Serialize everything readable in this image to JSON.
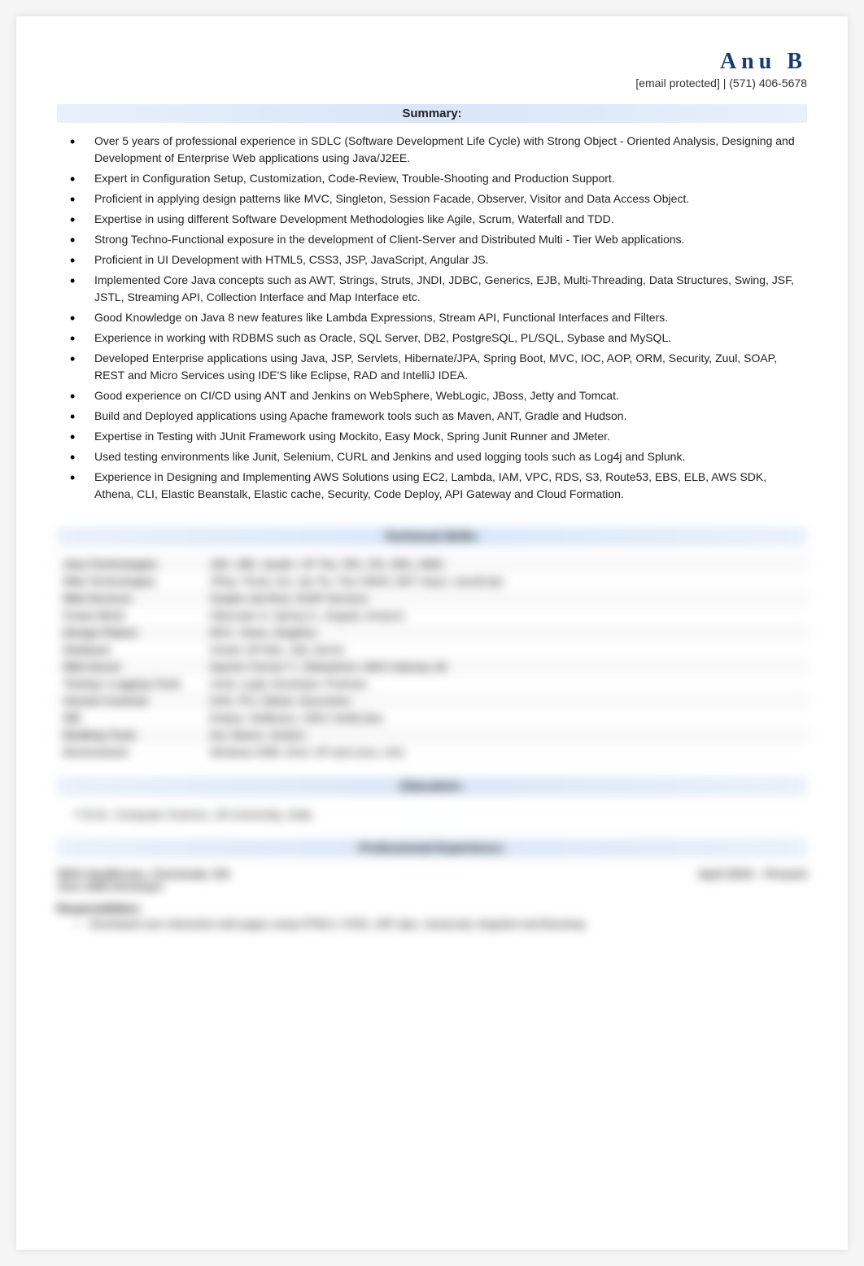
{
  "header": {
    "name": "Anu B",
    "contact": "[email protected] | (571) 406-5678"
  },
  "sections": {
    "summary_title": "Summary:",
    "skills_title": "Technical Skills:",
    "education_title": "Education:",
    "experience_title": "Professional Experience:"
  },
  "summary": [
    "Over 5 years of professional experience in SDLC (Software Development Life Cycle) with Strong Object - Oriented Analysis, Designing and Development of Enterprise Web applications using Java/J2EE.",
    "Expert in Configuration Setup, Customization, Code-Review, Trouble-Shooting and Production Support.",
    "Proficient in applying design patterns like MVC, Singleton, Session Facade, Observer, Visitor and Data Access Object.",
    "Expertise in using different Software Development Methodologies like Agile, Scrum, Waterfall and TDD.",
    "Strong Techno-Functional exposure in the development of Client-Server and Distributed Multi - Tier Web applications.",
    "Proficient in UI Development with HTML5, CSS3, JSP, JavaScript, Angular JS.",
    "Implemented Core Java concepts such as AWT, Strings, Struts, JNDI, JDBC, Generics, EJB, Multi-Threading, Data Structures, Swing, JSF, JSTL, Streaming API, Collection Interface and Map Interface etc.",
    "Good Knowledge on Java 8 new features like Lambda Expressions, Stream API, Functional Interfaces and Filters.",
    "Experience in working with RDBMS such as Oracle, SQL Server, DB2, PostgreSQL, PL/SQL, Sybase and MySQL.",
    "Developed Enterprise applications using Java, JSP, Servlets, Hibernate/JPA, Spring Boot, MVC, IOC, AOP, ORM, Security, Zuul, SOAP, REST and Micro Services using IDE'S like Eclipse, RAD and IntelliJ IDEA.",
    "Good experience on CI/CD using ANT and Jenkins on WebSphere, WebLogic, JBoss, Jetty and Tomcat.",
    "Build and Deployed applications using Apache framework tools such as Maven, ANT, Gradle and Hudson.",
    "Expertise in Testing with JUnit Framework using Mockito, Easy Mock, Spring Junit Runner and JMeter.",
    "Used testing environments like Junit, Selenium, CURL and Jenkins and used logging tools such as Log4j and Splunk.",
    "Experience in Designing and Implementing AWS Solutions using EC2, Lambda, IAM, VPC, RDS, S3, Route53, EBS, ELB, AWS SDK, Athena, CLI, Elastic Beanstalk, Elastic cache, Security, Code Deploy, API Gateway and Cloud Formation."
  ],
  "skills": [
    [
      "Java Technologies",
      "JDK, JRE, Java8+, NT Tier, JPA, JTA, JMS, JDBC"
    ],
    [
      "Web Technologies",
      "JPlay, Thunk, Ext, Jqx Tsx, Test JWINJ, BKT slspct, JavaScript"
    ],
    [
      "Web Services",
      "Soaplis Jad Rest, SOAP Services"
    ],
    [
      "Frame Work",
      "Hibernate 3+ Spring 4+, Angular, Amazon"
    ],
    [
      "Design Pattern",
      "MVC, Views, Singleton"
    ],
    [
      "Database",
      "Oracle, MYSQL, SQL Server"
    ],
    [
      "Web Server",
      "Apache Tomcat 7+, Websphere, AWS Gateway Jkl"
    ],
    [
      "Testing / Logging Tools",
      "JUnit, Log4j, Developer, Postman"
    ],
    [
      "Version Controls",
      "SVN, TFs, Github, Sourcetree"
    ],
    [
      "IDE",
      "Eclipse, NetBeans, JDEV Intellij Idea"
    ],
    [
      "Building Tools",
      "Ant, Maven, Jenkins"
    ],
    [
      "Environment",
      "Windows 2008, 2013, XP and Linux, Unix"
    ]
  ],
  "education": "B.Sc. Computer Science, JN University, India",
  "experience": {
    "company": "SEIU Healthcare, Cincinnati, OH",
    "dates": "April 2019 – Present",
    "role": "Java J2EE Developer",
    "responsibilities_label": "Responsibilities:",
    "resp1": "Developed user interactive web pages using HTML5, CSS3, JSP, Ajax, Javascript, Angular4 and Boostrap."
  }
}
